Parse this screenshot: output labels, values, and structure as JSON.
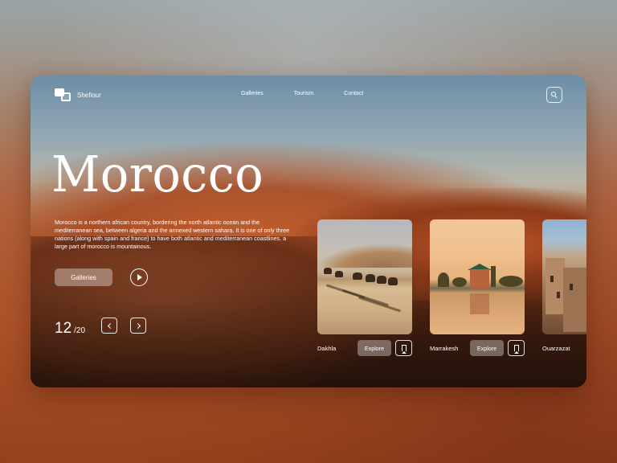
{
  "brand": {
    "name": "Shefiour"
  },
  "nav": [
    {
      "label": "Galleries"
    },
    {
      "label": "Tourism"
    },
    {
      "label": "Contact"
    }
  ],
  "hero": {
    "title": "Morocco",
    "description": "Morocco is a northern african country, bordering the north atlantic ocean and the mediterranean sea, between algeria and the annexed western sahara. It is one of only three nations (along with spain and france) to have both atlantic and mediterranean coastlines. a large part of morocco is mountainous.",
    "galleries_button": "Galleries"
  },
  "pagination": {
    "current": "12",
    "total": "/20"
  },
  "destinations": [
    {
      "name": "Dakhla",
      "explore_label": "Explore"
    },
    {
      "name": "Marrakesh",
      "explore_label": "Explore"
    },
    {
      "name": "Ouarzazat"
    }
  ],
  "icons": {
    "logo": "logo-icon",
    "search": "search-icon",
    "play": "play-icon",
    "prev": "chevron-left-icon",
    "next": "chevron-right-icon",
    "bookmark": "bookmark-icon"
  },
  "colors": {
    "accent": "#b25a30",
    "text": "#ffffff"
  }
}
